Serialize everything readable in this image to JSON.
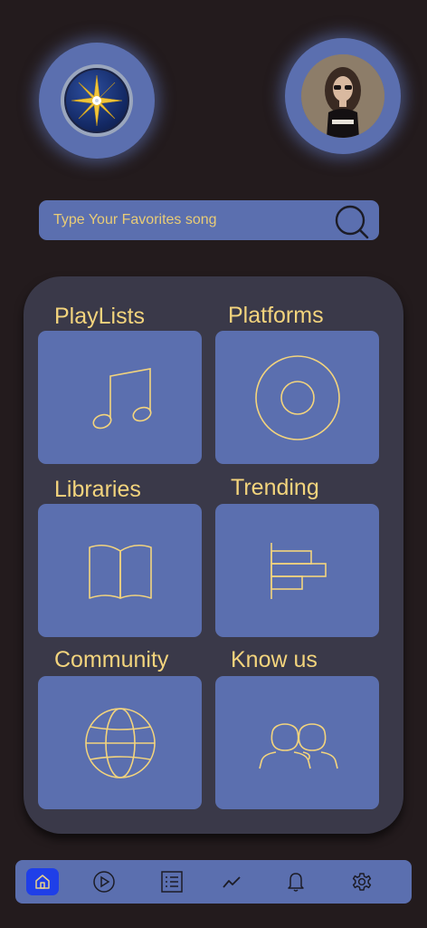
{
  "search": {
    "placeholder": "Type Your Favorites song"
  },
  "header": {
    "logo_icon": "compass-logo-icon",
    "avatar": "user-avatar"
  },
  "tiles": [
    {
      "label": "PlayLists",
      "icon": "music-note-icon"
    },
    {
      "label": "Platforms",
      "icon": "disc-icon"
    },
    {
      "label": "Libraries",
      "icon": "open-book-icon"
    },
    {
      "label": "Trending",
      "icon": "bar-chart-icon"
    },
    {
      "label": "Community",
      "icon": "globe-icon"
    },
    {
      "label": "Know us",
      "icon": "people-icon"
    }
  ],
  "nav": [
    {
      "icon": "home-icon",
      "active": true
    },
    {
      "icon": "play-icon",
      "active": false
    },
    {
      "icon": "list-icon",
      "active": false
    },
    {
      "icon": "trend-icon",
      "active": false
    },
    {
      "icon": "bell-icon",
      "active": false
    },
    {
      "icon": "gear-icon",
      "active": false
    }
  ],
  "colors": {
    "background": "#231b1d",
    "accent": "#5b6faf",
    "panel": "#3a3949",
    "text": "#f3d47d",
    "active_nav": "#1f3fe8"
  }
}
